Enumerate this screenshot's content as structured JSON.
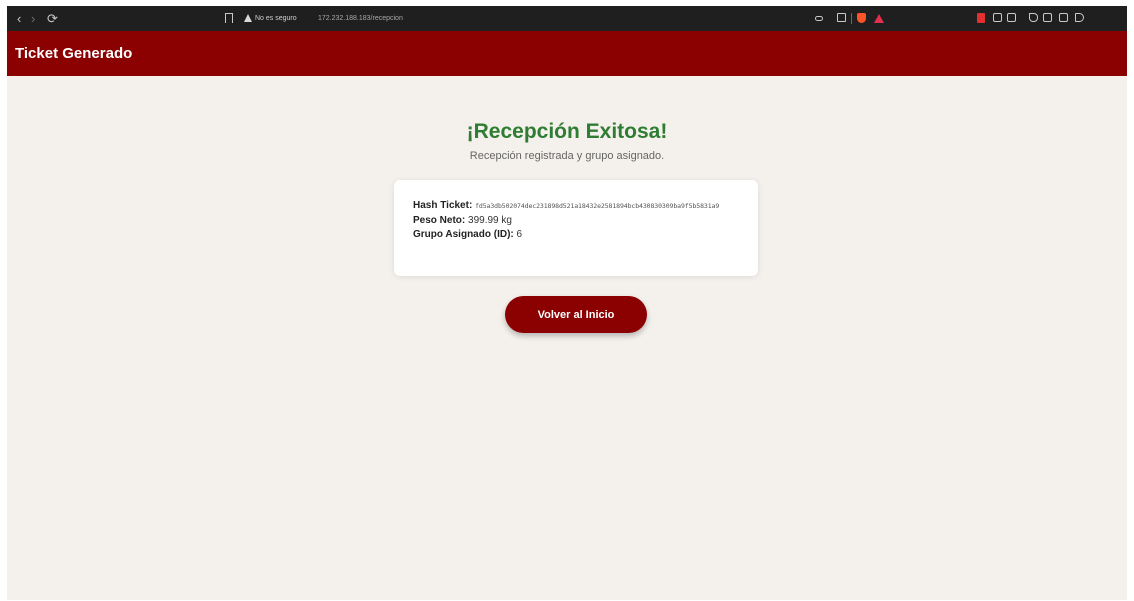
{
  "browser": {
    "back_glyph": "‹",
    "forward_glyph": "›",
    "reload_glyph": "⟳",
    "security_label": "No es seguro",
    "url": "172.232.188.183/recepcion"
  },
  "header": {
    "title": "Ticket Generado"
  },
  "main": {
    "title": "¡Recepción Exitosa!",
    "subtitle": "Recepción registrada y grupo asignado.",
    "title_color": "#2e7d32",
    "card": {
      "hash_label": "Hash Ticket:",
      "hash_value": "fd5a3db502074dec231898d521a18432e2581894bcb430830309ba9f5b5831a9",
      "peso_label": "Peso Neto:",
      "peso_value": "399.99 kg",
      "grupo_label": "Grupo Asignado (ID):",
      "grupo_value": "6"
    },
    "button": {
      "label": "Volver al Inicio"
    }
  },
  "colors": {
    "brand": "#8b0000",
    "background": "#f4f0ec",
    "success": "#2e7d32"
  },
  "icons": [
    "back-icon",
    "forward-icon",
    "reload-icon",
    "bookmark-icon",
    "warning-icon",
    "key-icon",
    "share-icon",
    "brave-shield-icon",
    "brave-rewards-icon",
    "extension-icon",
    "puzzle-icon",
    "reading-list-icon",
    "media-icon",
    "sidebar-icon",
    "wallet-icon",
    "leo-icon"
  ]
}
